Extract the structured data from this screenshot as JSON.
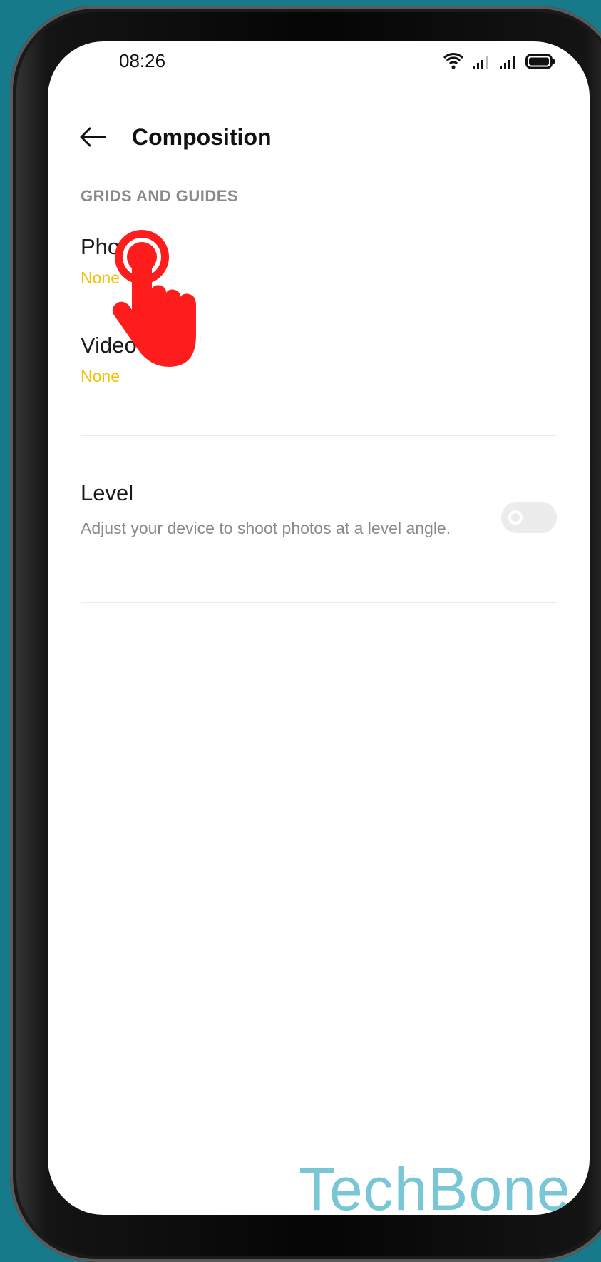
{
  "status_bar": {
    "time": "08:26",
    "icons": [
      "wifi-icon",
      "signal-icon",
      "signal-icon",
      "battery-icon"
    ]
  },
  "header": {
    "back_icon": "arrow-left-icon",
    "title": "Composition"
  },
  "sections": {
    "grids_and_guides": {
      "header": "GRIDS AND GUIDES",
      "items": [
        {
          "label": "Photo",
          "value": "None"
        },
        {
          "label": "Video",
          "value": "None"
        }
      ]
    },
    "level": {
      "label": "Level",
      "description": "Adjust your device to shoot photos at a level angle.",
      "enabled": false
    }
  },
  "watermark": "TechBone",
  "colors": {
    "background": "#177a8b",
    "value_accent": "#f2c200",
    "tap_indicator": "#ff1c1c",
    "watermark": "#79c7d6"
  }
}
